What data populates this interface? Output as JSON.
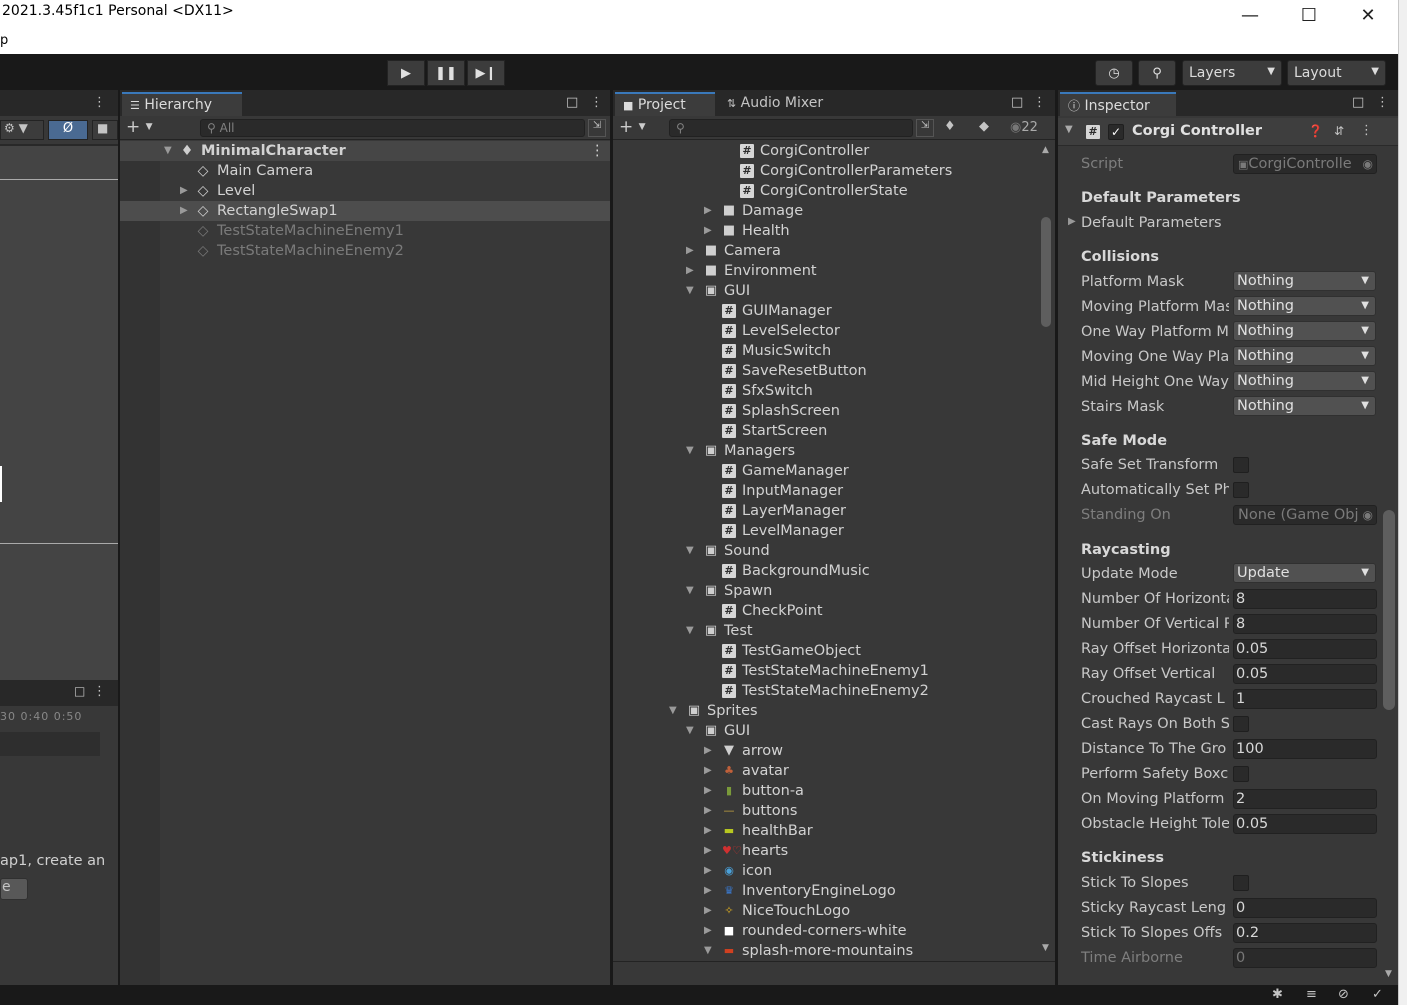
{
  "window": {
    "title": "2021.3.45f1c1 Personal <DX11>",
    "menu_fragment": "p"
  },
  "toolbar": {
    "layers_label": "Layers",
    "layout_label": "Layout"
  },
  "hierarchy": {
    "tab": "Hierarchy",
    "search_placeholder": "All",
    "items": [
      {
        "label": "MinimalCharacter"
      },
      {
        "label": "Main Camera"
      },
      {
        "label": "Level"
      },
      {
        "label": "RectangleSwap1"
      },
      {
        "label": "TestStateMachineEnemy1"
      },
      {
        "label": "TestStateMachineEnemy2"
      }
    ]
  },
  "left_panel": {
    "ruler_ticks": [
      "30",
      "0:40",
      "0:50"
    ],
    "hint_text": "ap1, create an",
    "button_fragment": "e"
  },
  "project": {
    "tab": "Project",
    "tab2": "Audio Mixer",
    "hidden_count": "22",
    "items": [
      {
        "label": "CorgiController"
      },
      {
        "label": "CorgiControllerParameters"
      },
      {
        "label": "CorgiControllerState"
      },
      {
        "label": "Damage"
      },
      {
        "label": "Health"
      },
      {
        "label": "Camera"
      },
      {
        "label": "Environment"
      },
      {
        "label": "GUI"
      },
      {
        "label": "GUIManager"
      },
      {
        "label": "LevelSelector"
      },
      {
        "label": "MusicSwitch"
      },
      {
        "label": "SaveResetButton"
      },
      {
        "label": "SfxSwitch"
      },
      {
        "label": "SplashScreen"
      },
      {
        "label": "StartScreen"
      },
      {
        "label": "Managers"
      },
      {
        "label": "GameManager"
      },
      {
        "label": "InputManager"
      },
      {
        "label": "LayerManager"
      },
      {
        "label": "LevelManager"
      },
      {
        "label": "Sound"
      },
      {
        "label": "BackgroundMusic"
      },
      {
        "label": "Spawn"
      },
      {
        "label": "CheckPoint"
      },
      {
        "label": "Test"
      },
      {
        "label": "TestGameObject"
      },
      {
        "label": "TestStateMachineEnemy1"
      },
      {
        "label": "TestStateMachineEnemy2"
      },
      {
        "label": "Sprites"
      },
      {
        "label": "GUI"
      },
      {
        "label": "arrow"
      },
      {
        "label": "avatar"
      },
      {
        "label": "button-a"
      },
      {
        "label": "buttons"
      },
      {
        "label": "healthBar"
      },
      {
        "label": "hearts"
      },
      {
        "label": "icon"
      },
      {
        "label": "InventoryEngineLogo"
      },
      {
        "label": "NiceTouchLogo"
      },
      {
        "label": "rounded-corners-white"
      },
      {
        "label": "splash-more-mountains"
      }
    ]
  },
  "inspector": {
    "tab": "Inspector",
    "component_title": "Corgi Controller",
    "script_label": "Script",
    "script_value": "CorgiControlle",
    "h_default": "Default Parameters",
    "default_params_foldout": "Default Parameters",
    "h_collisions": "Collisions",
    "platform_mask": {
      "label": "Platform Mask",
      "value": "Nothing"
    },
    "moving_platform_mask": {
      "label": "Moving Platform Mas",
      "value": "Nothing"
    },
    "one_way_platform_mask": {
      "label": "One Way Platform M",
      "value": "Nothing"
    },
    "moving_one_way_platform_mask": {
      "label": "Moving One Way Pla",
      "value": "Nothing"
    },
    "mid_height_one_way": {
      "label": "Mid Height One Way",
      "value": "Nothing"
    },
    "stairs_mask": {
      "label": "Stairs Mask",
      "value": "Nothing"
    },
    "h_safe": "Safe Mode",
    "safe_set_transform": "Safe Set Transform",
    "auto_set_physics": "Automatically Set Ph",
    "standing_on": {
      "label": "Standing On",
      "value": "None (Game Obj"
    },
    "h_raycasting": "Raycasting",
    "update_mode": {
      "label": "Update Mode",
      "value": "Update"
    },
    "num_horizontal": {
      "label": "Number Of Horizonta",
      "value": "8"
    },
    "num_vertical": {
      "label": "Number Of Vertical R",
      "value": "8"
    },
    "ray_offset_h": {
      "label": "Ray Offset Horizonta",
      "value": "0.05"
    },
    "ray_offset_v": {
      "label": "Ray Offset Vertical",
      "value": "0.05"
    },
    "crouched_raycast": {
      "label": "Crouched Raycast L",
      "value": "1"
    },
    "cast_rays_both": "Cast Rays On Both S",
    "distance_ground": {
      "label": "Distance To The Gro",
      "value": "100"
    },
    "perform_safety": "Perform Safety Boxc",
    "on_moving_platform": {
      "label": "On Moving Platform I",
      "value": "2"
    },
    "obstacle_height": {
      "label": "Obstacle Height Tole",
      "value": "0.05"
    },
    "h_stickiness": "Stickiness",
    "stick_to_slopes": "Stick To Slopes",
    "sticky_raycast_length": {
      "label": "Sticky Raycast Leng",
      "value": "0"
    },
    "stick_to_slopes_offset": {
      "label": "Stick To Slopes Offs",
      "value": "0.2"
    },
    "time_airborne": {
      "label": "Time Airborne",
      "value": "0"
    }
  }
}
